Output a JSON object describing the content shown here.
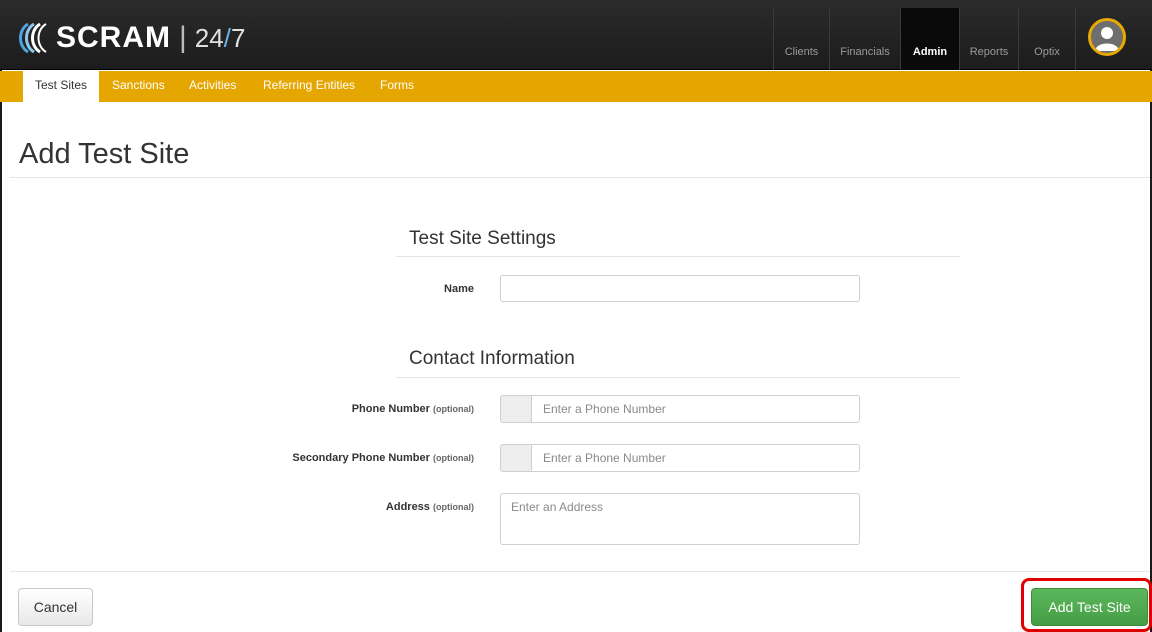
{
  "brand": {
    "name": "SCRAM",
    "separator": "|",
    "suffix_prefix": "24",
    "suffix_slash": "/",
    "suffix_end": "7",
    "accent": "#e6a600"
  },
  "nav": {
    "items": [
      {
        "label": "Clients"
      },
      {
        "label": "Financials"
      },
      {
        "label": "Admin",
        "active": true
      },
      {
        "label": "Reports"
      },
      {
        "label": "Optix"
      }
    ],
    "avatar_icon": "user-avatar-icon"
  },
  "subnav": {
    "items": [
      {
        "label": "Test Sites",
        "active": true
      },
      {
        "label": "Sanctions"
      },
      {
        "label": "Activities"
      },
      {
        "label": "Referring Entities"
      },
      {
        "label": "Forms"
      }
    ]
  },
  "page": {
    "title": "Add Test Site"
  },
  "form": {
    "settings": {
      "title": "Test Site Settings",
      "name_label": "Name",
      "name_value": ""
    },
    "contact": {
      "title": "Contact Information",
      "optional": "(optional)",
      "phone_label": "Phone Number",
      "phone_placeholder": "Enter a Phone Number",
      "secondary_phone_label": "Secondary Phone Number",
      "secondary_phone_placeholder": "Enter a Phone Number",
      "address_label": "Address",
      "address_placeholder": "Enter an Address"
    }
  },
  "actions": {
    "cancel_label": "Cancel",
    "submit_label": "Add Test Site",
    "submit_color": "#5cb85c"
  }
}
